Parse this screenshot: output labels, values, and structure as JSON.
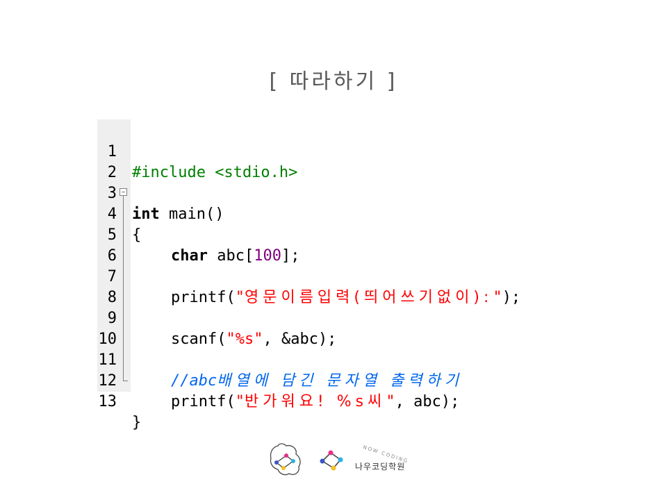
{
  "slide": {
    "title": "[ 따라하기 ]"
  },
  "code": {
    "lines": [
      {
        "num": "1",
        "pp": "#include <stdio.h>"
      },
      {
        "num": "2"
      },
      {
        "num": "3",
        "kw": "int",
        "rest": " main()"
      },
      {
        "num": "4",
        "rest": "{"
      },
      {
        "num": "5",
        "kw": "char",
        "pre": " abc[",
        "nm": "100",
        "post": "];"
      },
      {
        "num": "6"
      },
      {
        "num": "7",
        "pre": "printf(",
        "str_a": "\"",
        "str_kr": "영문이름입력(띄어쓰기없이):",
        "str_b": "\"",
        "post": ");"
      },
      {
        "num": "8"
      },
      {
        "num": "9",
        "pre": "scanf(",
        "str": "\"%s\"",
        "post": ", &abc);"
      },
      {
        "num": "10"
      },
      {
        "num": "11",
        "cmt_a": "//abc",
        "cmt_kr": "배열에 담긴 문자열 출력하기"
      },
      {
        "num": "12",
        "pre": "printf(",
        "str_a": "\"",
        "str_kr": "반가워요! %s씨",
        "str_b": "\"",
        "post": ", abc);"
      },
      {
        "num": "13",
        "rest": "}"
      }
    ]
  },
  "logo": {
    "arc_text": "NOW CODING",
    "academy_name": "나우코딩학원"
  },
  "colors": {
    "preprocessor": "#008000",
    "number": "#800080",
    "string": "#ff0000",
    "comment": "#0066ee",
    "gutter": "#efefef"
  }
}
